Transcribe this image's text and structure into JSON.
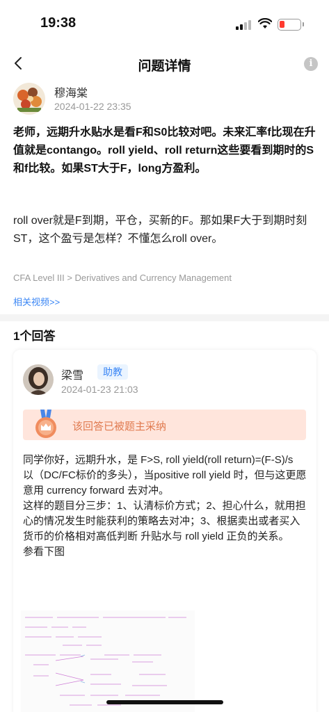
{
  "status_bar": {
    "time": "19:38"
  },
  "header": {
    "title": "问题详情",
    "back_label": "<",
    "info_label": "i"
  },
  "question": {
    "author": "穆海棠",
    "timestamp": "2024-01-22 23:35",
    "body_bold": "老师，远期升水贴水是看F和S0比较对吧。未来汇率f比现在升值就是contango。roll yield、roll return这些要看到期时的S和f比较。如果ST大于F，long方盈利。",
    "body": "roll over就是F到期，平仓，买新的F。那如果F大于到期时刻ST，这个盈亏是怎样？不懂怎么roll over。",
    "category": "CFA Level III > Derivatives and Currency Management",
    "video_link": "相关视频>>"
  },
  "answers": {
    "count_label": "1个回答",
    "items": [
      {
        "author": "梁雪",
        "badge": "助教",
        "timestamp": "2024-01-23 21:03",
        "accepted_text": "该回答已被题主采纳",
        "lines": [
          "同学你好，远期升水，是 F>S, roll yield(roll return)=(F-S)/s",
          "以（DC/FC标价的多头），当positive roll yield 时，但与这更愿意用 currency forward 去对冲。",
          "这样的题目分三步：1、认清标价方式；2、担心什么，就用担心的情况发生时能获利的策略去对冲；3、根据卖出或者买入货币的价格相对高低判断 升贴水与 roll yield 正负的关系。",
          "参看下图"
        ]
      }
    ]
  },
  "colors": {
    "accent": "#3a86f5",
    "accepted_bg": "#ffe5dc",
    "accepted_text": "#e07a4f",
    "battery": "#ff3b30"
  }
}
